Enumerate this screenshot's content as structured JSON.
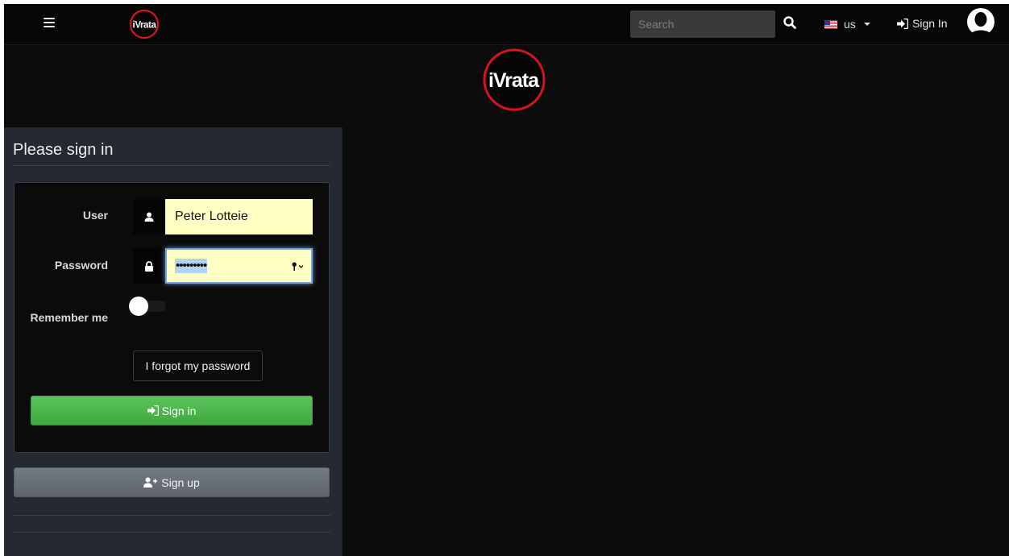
{
  "navbar": {
    "brand": "iVrata",
    "search_placeholder": "Search",
    "language": "us",
    "signin_label": "Sign In",
    "icons": [
      "menu-icon",
      "search-icon",
      "us-flag-icon",
      "caret-down-icon",
      "sign-in-icon",
      "user-avatar-icon"
    ]
  },
  "hero": {
    "brand": "iVrata"
  },
  "signin_form": {
    "title": "Please sign in",
    "user_label": "User",
    "user_value": "Peter Lotteie",
    "password_label": "Password",
    "password_mask": "•••••••••",
    "remember_label": "Remember me",
    "remember_checked": false,
    "forgot_label": "I forgot my password",
    "submit_label": "Sign in",
    "signup_label": "Sign up",
    "icons": [
      "user-icon",
      "lock-icon",
      "key-icon",
      "sign-in-icon",
      "user-plus-icon"
    ]
  },
  "colors": {
    "background": "#0c0c0c",
    "panel": "#252a30",
    "brand_red": "#d8141e",
    "field_autofill": "#ffffc4",
    "submit_green": "#4cb84c",
    "signup_gray": "#6a7178"
  }
}
